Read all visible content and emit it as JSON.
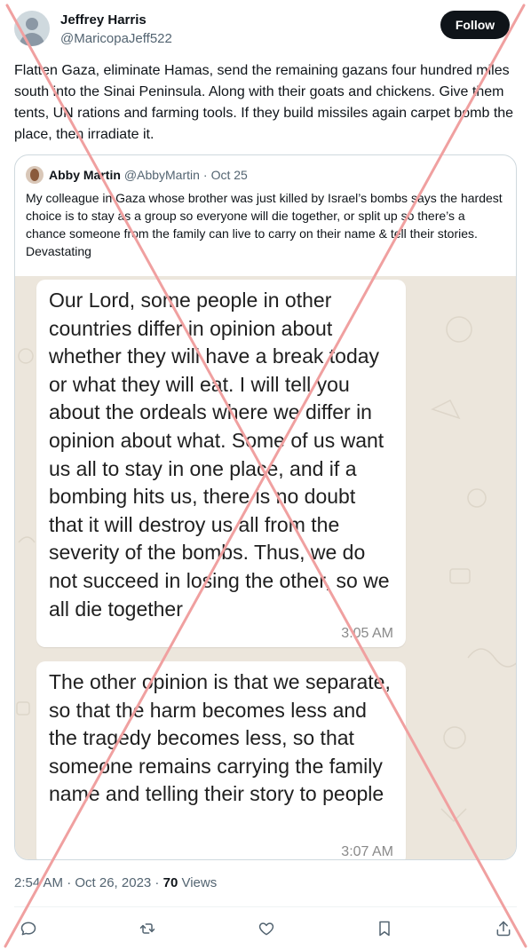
{
  "author": {
    "name": "Jeffrey Harris",
    "handle": "@MaricopaJeff522"
  },
  "follow_label": "Follow",
  "tweet_text": "Flatten Gaza, eliminate Hamas, send the remaining gazans four hundred miles south into the Sinai Peninsula. Along with their goats and chickens. Give them tents, UN rations and farming tools. If they build missiles again carpet bomb the place, then irradiate it.",
  "quoted": {
    "name": "Abby Martin",
    "handle": "@AbbyMartin",
    "separator": "·",
    "date": "Oct 25",
    "text": "My colleague in Gaza whose brother was just killed by Israel’s bombs says the hardest choice is to stay as a group so everyone will die together, or split up so there’s a chance someone from the family can live to carry on their name & tell their stories. Devastating",
    "messages": [
      {
        "text": "Our Lord, some people in other countries differ in opinion about whether they will have a break today or what they will eat. I will tell you about the ordeals where we differ in opinion about what. Some of us want us all to stay in one place, and if a bombing hits us, there is no doubt that it will destroy us all from the severity of the bombs. Thus, we do not succeed in losing the other, so we all die together",
        "time": "3:05 AM"
      },
      {
        "text": "The other opinion is that we separate, so that the harm becomes less and the tragedy becomes less, so that someone remains carrying the family name and telling their story to people",
        "time": "3:07 AM"
      }
    ]
  },
  "meta": {
    "timestamp": "2:54 AM · Oct 26, 2023",
    "separator": " · ",
    "views_count": "70",
    "views_label": " Views"
  },
  "actions": [
    "reply-icon",
    "retweet-icon",
    "like-icon",
    "bookmark-icon",
    "share-icon"
  ],
  "colors": {
    "text_primary": "#0f1419",
    "text_secondary": "#536471",
    "border": "#cfd9de",
    "chat_background": "#ece6dc",
    "overlay_x": "#f0a0a0"
  }
}
